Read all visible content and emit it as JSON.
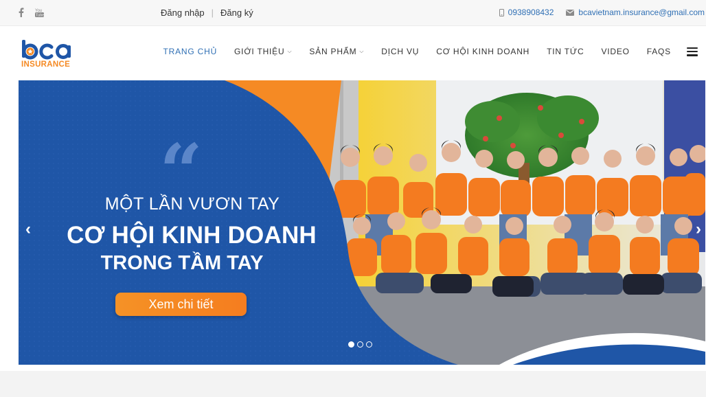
{
  "topbar": {
    "social": [
      {
        "name": "facebook-icon",
        "glyph": "f"
      },
      {
        "name": "youtube-icon",
        "glyph": "You Tube"
      }
    ],
    "login_label": "Đăng nhập",
    "separator": "|",
    "register_label": "Đăng ký",
    "phone": "0938908432",
    "email": "bcavietnam.insurance@gmail.com"
  },
  "header": {
    "logo": {
      "text_top": "bca",
      "text_bottom": "INSURANCE"
    },
    "nav": [
      {
        "label": "TRANG CHỦ",
        "active": true,
        "dropdown": false
      },
      {
        "label": "GIỚI THIỆU",
        "active": false,
        "dropdown": true
      },
      {
        "label": "SẢN PHẨM",
        "active": false,
        "dropdown": true
      },
      {
        "label": "DỊCH VỤ",
        "active": false,
        "dropdown": false
      },
      {
        "label": "CƠ HỘI KINH DOANH",
        "active": false,
        "dropdown": false
      },
      {
        "label": "TIN TỨC",
        "active": false,
        "dropdown": false
      },
      {
        "label": "VIDEO",
        "active": false,
        "dropdown": false
      },
      {
        "label": "FAQS",
        "active": false,
        "dropdown": false
      }
    ],
    "menu_icon": "hamburger-icon"
  },
  "hero": {
    "line1": "MỘT LẦN VƯƠN TAY",
    "line2": "CƠ HỘI KINH DOANH",
    "line3": "TRONG TẦM TAY",
    "cta_label": "Xem chi tiết",
    "prev_arrow": "‹",
    "next_arrow": "›",
    "slides_total": 3,
    "active_slide": 1
  },
  "colors": {
    "accent_blue": "#2f6fb4",
    "hero_blue": "#1f56a7",
    "orange": "#f58a24"
  }
}
